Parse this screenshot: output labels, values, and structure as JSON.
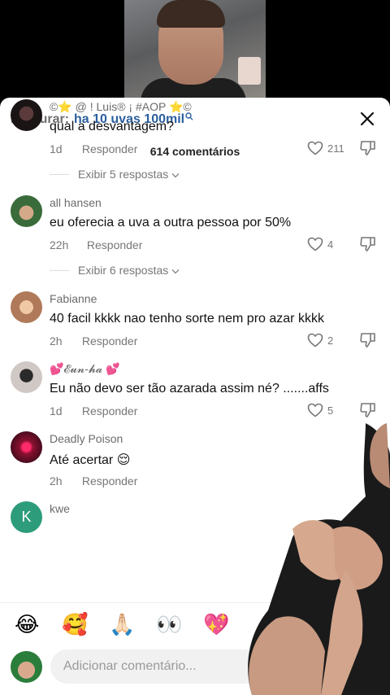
{
  "search": {
    "label": "Procurar:",
    "query": "ha 10 uvas 100mil"
  },
  "header": {
    "comment_count": "614 comentários"
  },
  "comments": [
    {
      "username": "©⭐ @ ! Luis® ¡ #AOP ⭐©",
      "text": "qual a desvantagem?",
      "time": "1d",
      "reply": "Responder",
      "likes": "211",
      "view_replies": "Exibir 5 respostas",
      "avatar_color": "#2a2222"
    },
    {
      "username": "all hansen",
      "text": "eu oferecia a uva a outra pessoa por 50%",
      "time": "22h",
      "reply": "Responder",
      "likes": "4",
      "view_replies": "Exibir 6 respostas",
      "avatar_color": "#3a6b3a"
    },
    {
      "username": "Fabianne",
      "text": "40 facil kkkk nao tenho sorte nem pro azar kkkk",
      "time": "2h",
      "reply": "Responder",
      "likes": "2",
      "avatar_color": "#b07a5a"
    },
    {
      "username": "💕𝓔𝓾𝓷-𝓱𝓪 💕",
      "text": "Eu não devo ser tão azarada assim né? .......affs",
      "time": "1d",
      "reply": "Responder",
      "likes": "5",
      "avatar_color": "#d0c8c4"
    },
    {
      "username": "Deadly Poison",
      "text": "Até acertar 😌",
      "time": "2h",
      "reply": "Responder",
      "avatar_color": "#8a1030"
    },
    {
      "username": "kwe",
      "avatar_letter": "K",
      "avatar_color": "#2d9c7a"
    }
  ],
  "emoji_bar": [
    "😂",
    "🥰",
    "🙏🏻",
    "👀",
    "💖"
  ],
  "composer": {
    "placeholder": "Adicionar comentário..."
  },
  "colors": {
    "accent_link": "#2b5f9e",
    "sheet_bg": "#ffffff"
  }
}
